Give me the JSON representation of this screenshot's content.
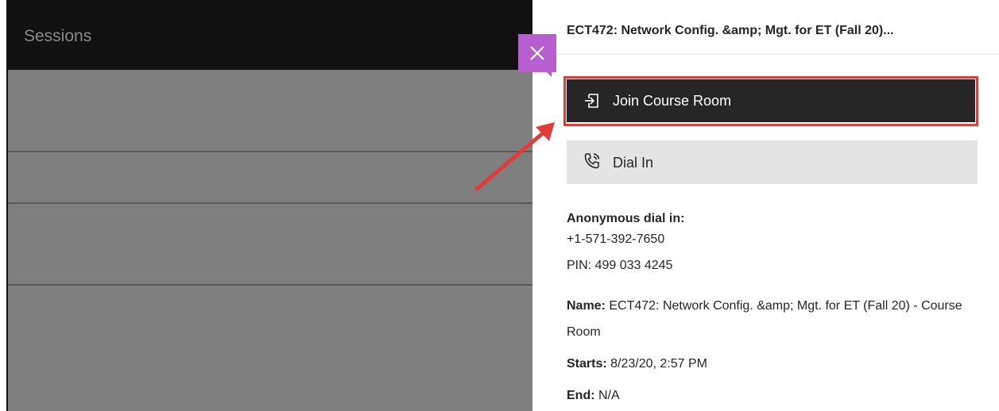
{
  "left": {
    "header_title": "Sessions"
  },
  "panel": {
    "title": "ECT472: Network Config. &amp; Mgt. for ET (Fall 20)...",
    "join_label": "Join Course Room",
    "dial_label": "Dial In",
    "anon_heading": "Anonymous dial in:",
    "phone": "+1-571-392-7650",
    "pin": "PIN: 499 033 4245",
    "name_label": "Name:",
    "name_value": "ECT472: Network Config. &amp; Mgt. for ET (Fall 20) - Course Room",
    "starts_label": "Starts:",
    "starts_value": "8/23/20, 2:57 PM",
    "end_label": "End:",
    "end_value": "N/A"
  },
  "icons": {
    "close": "close-icon",
    "join": "enter-icon",
    "dial": "phone-icon",
    "annotation": "arrow-icon"
  },
  "colors": {
    "close_button": "#b85fcf",
    "join_button": "#262626",
    "dial_button": "#e4e4e4",
    "highlight": "#e23b3b",
    "overlay": "#7f7f7f"
  }
}
